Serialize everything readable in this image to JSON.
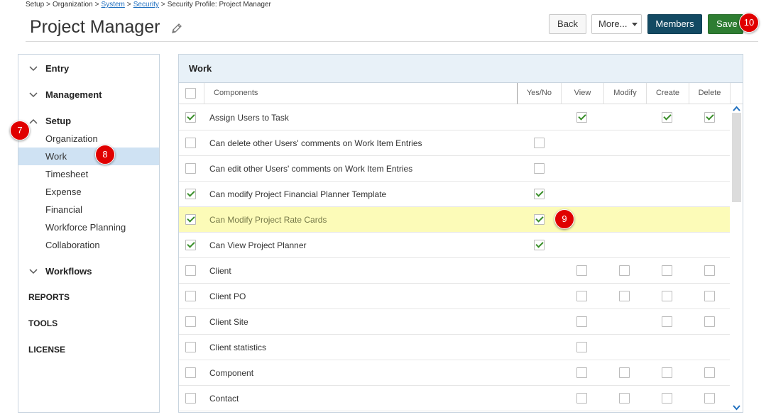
{
  "breadcrumb": [
    {
      "label": "Setup",
      "link": false
    },
    {
      "label": "Organization",
      "link": false
    },
    {
      "label": "System",
      "link": true
    },
    {
      "label": "Security",
      "link": true
    },
    {
      "label": "Security Profile: Project Manager",
      "link": false
    }
  ],
  "breadcrumb_separator": ">",
  "page_title": "Project Manager",
  "toolbar": {
    "back_label": "Back",
    "more_label": "More...",
    "members_label": "Members",
    "save_label": "Save"
  },
  "markers": {
    "m7": "7",
    "m8": "8",
    "m9": "9",
    "m10": "10"
  },
  "sidebar": {
    "groups": [
      {
        "label": "Entry",
        "expanded": false
      },
      {
        "label": "Management",
        "expanded": false
      },
      {
        "label": "Setup",
        "expanded": true
      },
      {
        "label": "Workflows",
        "expanded": false
      }
    ],
    "setup_items": [
      "Organization",
      "Work",
      "Timesheet",
      "Expense",
      "Financial",
      "Workforce Planning",
      "Collaboration"
    ],
    "selected_item": "Work",
    "plain_items": [
      "REPORTS",
      "TOOLS",
      "LICENSE"
    ]
  },
  "panel": {
    "title": "Work",
    "columns": {
      "components": "Components",
      "yesno": "Yes/No",
      "view": "View",
      "modify": "Modify",
      "create": "Create",
      "delete": "Delete"
    },
    "rows": [
      {
        "label": "Assign Users to Task",
        "checked": true,
        "yesno": null,
        "view": true,
        "modify": null,
        "create": true,
        "delete": true
      },
      {
        "label": "Can delete other Users' comments on Work Item Entries",
        "checked": false,
        "yesno": false,
        "view": null,
        "modify": null,
        "create": null,
        "delete": null
      },
      {
        "label": "Can edit other Users' comments on Work Item Entries",
        "checked": false,
        "yesno": false,
        "view": null,
        "modify": null,
        "create": null,
        "delete": null
      },
      {
        "label": "Can modify Project Financial Planner Template",
        "checked": true,
        "yesno": true,
        "view": null,
        "modify": null,
        "create": null,
        "delete": null
      },
      {
        "label": "Can Modify Project Rate Cards",
        "checked": true,
        "yesno": true,
        "view": null,
        "modify": null,
        "create": null,
        "delete": null,
        "highlight": true
      },
      {
        "label": "Can View Project Planner",
        "checked": true,
        "yesno": true,
        "view": null,
        "modify": null,
        "create": null,
        "delete": null
      },
      {
        "label": "Client",
        "checked": false,
        "yesno": null,
        "view": false,
        "modify": false,
        "create": false,
        "delete": false
      },
      {
        "label": "Client PO",
        "checked": false,
        "yesno": null,
        "view": false,
        "modify": false,
        "create": false,
        "delete": false
      },
      {
        "label": "Client Site",
        "checked": false,
        "yesno": null,
        "view": false,
        "modify": null,
        "create": false,
        "delete": false
      },
      {
        "label": "Client statistics",
        "checked": false,
        "yesno": null,
        "view": false,
        "modify": null,
        "create": null,
        "delete": null
      },
      {
        "label": "Component",
        "checked": false,
        "yesno": null,
        "view": false,
        "modify": false,
        "create": false,
        "delete": false
      },
      {
        "label": "Contact",
        "checked": false,
        "yesno": null,
        "view": false,
        "modify": false,
        "create": false,
        "delete": false
      }
    ]
  }
}
